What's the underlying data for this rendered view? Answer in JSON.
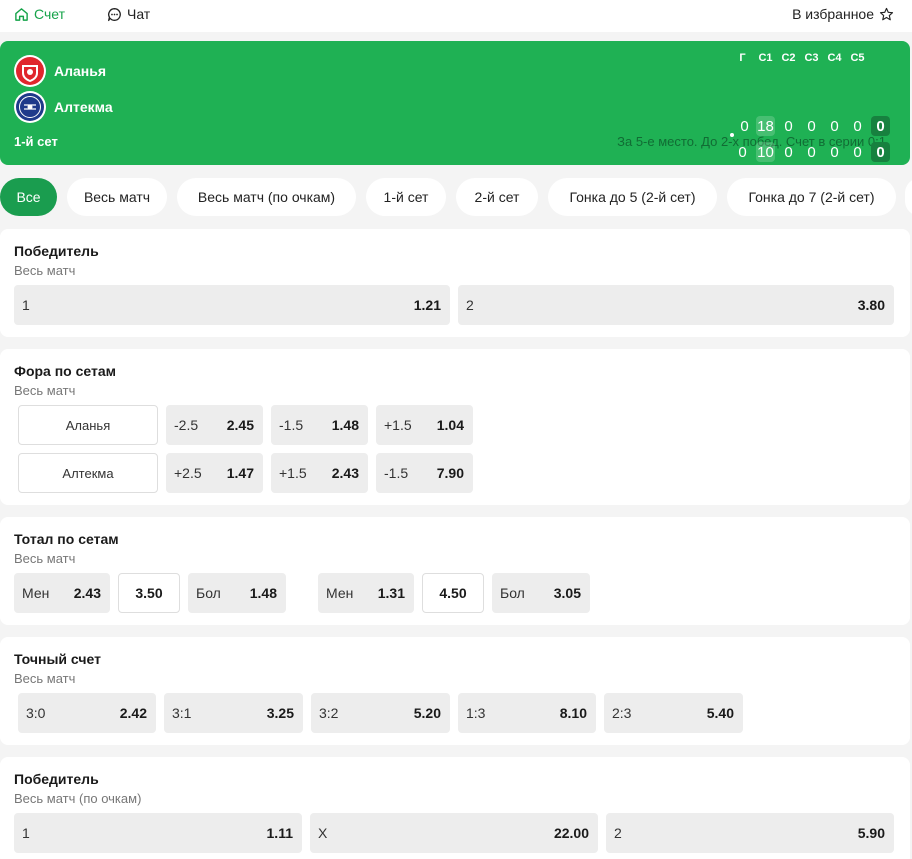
{
  "topbar": {
    "score_tab": "Счет",
    "chat_tab": "Чат",
    "favorite": "В избранное"
  },
  "scoreboard": {
    "team1": "Аланья",
    "team2": "Алтекма",
    "current_set": "1-й сет",
    "series_info": "За 5-е место. До 2-х побед. Счет в серии 0:1",
    "headers": [
      "Г",
      "С1",
      "С2",
      "С3",
      "С4",
      "С5"
    ],
    "rows": [
      [
        "0",
        "18",
        "0",
        "0",
        "0",
        "0",
        "0"
      ],
      [
        "0",
        "10",
        "0",
        "0",
        "0",
        "0",
        "0"
      ]
    ],
    "colors": {
      "background": "#1fb154",
      "accent": "#17813f"
    }
  },
  "filters": [
    "Все",
    "Весь матч",
    "Весь матч (по очкам)",
    "1-й сет",
    "2-й сет",
    "Гонка до 5 (2-й сет)",
    "Гонка до 7 (2-й сет)"
  ],
  "markets": {
    "winner": {
      "title": "Победитель",
      "subtitle": "Весь матч",
      "odds": [
        {
          "label": "1",
          "value": "1.21"
        },
        {
          "label": "2",
          "value": "3.80"
        }
      ]
    },
    "handicap": {
      "title": "Фора по сетам",
      "subtitle": "Весь матч",
      "rows": [
        {
          "team": "Аланья",
          "odds": [
            {
              "label": "-2.5",
              "value": "2.45"
            },
            {
              "label": "-1.5",
              "value": "1.48"
            },
            {
              "label": "+1.5",
              "value": "1.04"
            }
          ]
        },
        {
          "team": "Алтекма",
          "odds": [
            {
              "label": "+2.5",
              "value": "1.47"
            },
            {
              "label": "+1.5",
              "value": "2.43"
            },
            {
              "label": "-1.5",
              "value": "7.90"
            }
          ]
        }
      ]
    },
    "total": {
      "title": "Тотал по сетам",
      "subtitle": "Весь матч",
      "groups": [
        {
          "under_label": "Мен",
          "under_value": "2.43",
          "line": "3.50",
          "over_label": "Бол",
          "over_value": "1.48"
        },
        {
          "under_label": "Мен",
          "under_value": "1.31",
          "line": "4.50",
          "over_label": "Бол",
          "over_value": "3.05"
        }
      ]
    },
    "exact": {
      "title": "Точный счет",
      "subtitle": "Весь матч",
      "odds": [
        {
          "label": "3:0",
          "value": "2.42"
        },
        {
          "label": "3:1",
          "value": "3.25"
        },
        {
          "label": "3:2",
          "value": "5.20"
        },
        {
          "label": "1:3",
          "value": "8.10"
        },
        {
          "label": "2:3",
          "value": "5.40"
        }
      ]
    },
    "winner_points": {
      "title": "Победитель",
      "subtitle": "Весь матч (по очкам)",
      "odds": [
        {
          "label": "1",
          "value": "1.11"
        },
        {
          "label": "X",
          "value": "22.00"
        },
        {
          "label": "2",
          "value": "5.90"
        }
      ]
    }
  }
}
